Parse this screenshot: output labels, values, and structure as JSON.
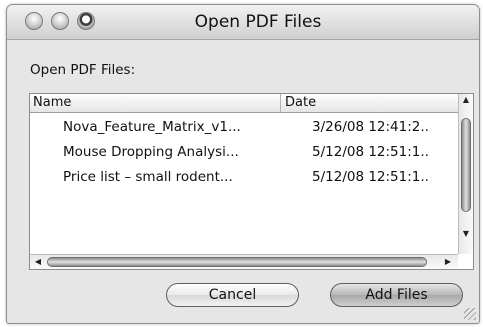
{
  "window": {
    "title": "Open PDF Files"
  },
  "label": "Open PDF Files:",
  "table": {
    "columns": [
      "Name",
      "Date"
    ],
    "rows": [
      {
        "name": "Nova_Feature_Matrix_v1...",
        "date": "3/26/08 12:41:2.."
      },
      {
        "name": "Mouse Dropping Analysi...",
        "date": "5/12/08 12:51:1.."
      },
      {
        "name": "Price list – small rodent...",
        "date": "5/12/08 12:51:1.."
      }
    ]
  },
  "buttons": {
    "cancel": "Cancel",
    "add": "Add Files"
  },
  "icons": {
    "scroll_up": "▲",
    "scroll_down": "▼",
    "scroll_left": "◀",
    "scroll_right": "▶"
  }
}
